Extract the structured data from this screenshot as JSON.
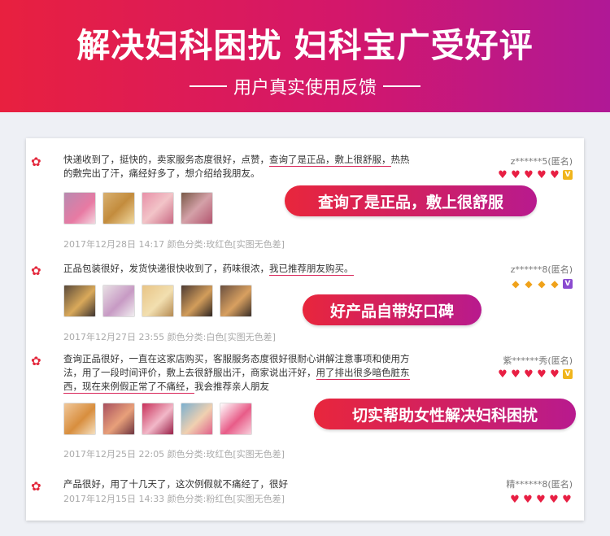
{
  "banner": {
    "title": "解决妇科困扰 妇科宝广受好评",
    "subtitle": "用户真实使用反馈"
  },
  "reviews": [
    {
      "text_1": "快递收到了，挺快的，卖家服务态度很好，点赞，",
      "highlight_1": "查询了是正品，敷上很舒服，",
      "text_2": "热热",
      "text_3": "的敷完出了汗，痛经好多了，想介绍给我朋友。",
      "user": "z******5(匿名)",
      "meta": "2017年12月28日 14:17 颜色分类:玫红色[实图无色差]",
      "callout": "查询了是正品，敷上很舒服",
      "rating_icon": "heart"
    },
    {
      "text_1": "正品包装很好，发货快递很快收到了，药味很浓，",
      "highlight_1": "我已推荐朋友购买。",
      "user": "z******8(匿名)",
      "meta": "2017年12月27日 23:55 颜色分类:白色[实图无色差]",
      "callout": "好产品自带好口碑",
      "rating_icon": "diamond"
    },
    {
      "text_1": "查询正品很好，一直在这家店购买，客服服务态度很好很耐心讲解注意事项和使用方",
      "text_2": "法，用了一段时间评价，敷上去很舒服出汗，商家说出汗好，",
      "highlight_1": "用了排出很多暗色脏东",
      "highlight_2": "西，现在来例假正常了不痛经，",
      "text_3": "我会推荐亲人朋友",
      "user": "紫******秀(匿名)",
      "meta": "2017年12月25日 22:05 颜色分类:玫红色[实图无色差]",
      "callout": "切实帮助女性解决妇科困扰",
      "rating_icon": "heart"
    },
    {
      "text_1": "产品很好，用了十几天了，这次例假就不痛经了，很好",
      "user": "精******8(匿名)",
      "meta": "2017年12月15日 14:33 颜色分类:粉红色[实图无色差]",
      "rating_icon": "heart"
    }
  ],
  "colors": {
    "banner_start": "#e8203f",
    "banner_end": "#b01896",
    "highlight": "#d9265a",
    "heart": "#e81f43",
    "diamond": "#f0a21a"
  }
}
